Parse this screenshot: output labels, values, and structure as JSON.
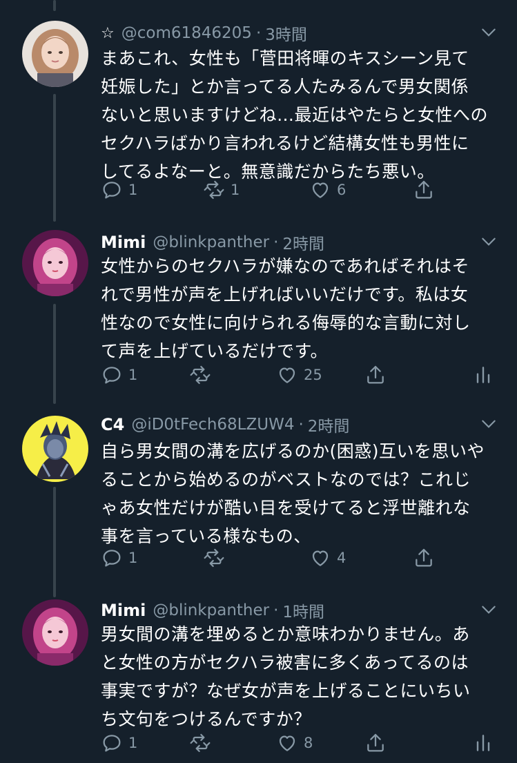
{
  "tweets": [
    {
      "star": "☆",
      "name": "",
      "handle": "@com61846205",
      "time": "3時間",
      "lines": [
        "まあこれ、女性も「菅田将暉のキスシーン見て",
        "妊娠した」とか言ってる人たみるんで男女関係",
        "ないと思いますけどね…最近はやたらと女性への",
        "セクハラばかり言われるけど結構女性も男性に",
        "してるよなーと。無意識だからたち悪い。"
      ],
      "replies": "1",
      "retweets": "1",
      "likes": "6",
      "show_analytics": false
    },
    {
      "star": "",
      "name": "Mimi",
      "handle": "@blinkpanther",
      "time": "2時間",
      "lines": [
        "女性からのセクハラが嫌なのであればそれはそ",
        "れで男性が声を上げればいいだけです。私は女",
        "性なので女性に向けられる侮辱的な言動に対し",
        "て声を上げているだけです。"
      ],
      "replies": "1",
      "retweets": "",
      "likes": "25",
      "show_analytics": true
    },
    {
      "star": "",
      "name": "C4",
      "handle": "@iD0tFech68LZUW4",
      "time": "2時間",
      "lines": [
        "自ら男女間の溝を広げるのか(困惑)互いを思いや",
        "ることから始めるのがベストなのでは？これじ",
        "ゃあ女性だけが酷い目を受けてると浮世離れな",
        "事を言っている様なもの、"
      ],
      "replies": "1",
      "retweets": "",
      "likes": "4",
      "show_analytics": false
    },
    {
      "star": "",
      "name": "Mimi",
      "handle": "@blinkpanther",
      "time": "1時間",
      "lines": [
        "男女間の溝を埋めるとか意味わかりません。あ",
        "と女性の方がセクハラ被害に多くあってるのは",
        "事実ですが？なぜ女が声を上げることにいちい",
        "ち文句をつけるんですか？"
      ],
      "replies": "1",
      "retweets": "",
      "likes": "8",
      "show_analytics": true
    }
  ],
  "colors": {
    "background": "#15202b",
    "secondary_text": "#8899a6",
    "thread_line": "#38444d"
  },
  "icons": [
    "reply-icon",
    "retweet-icon",
    "like-icon",
    "share-icon",
    "analytics-icon",
    "caret-down-icon"
  ]
}
